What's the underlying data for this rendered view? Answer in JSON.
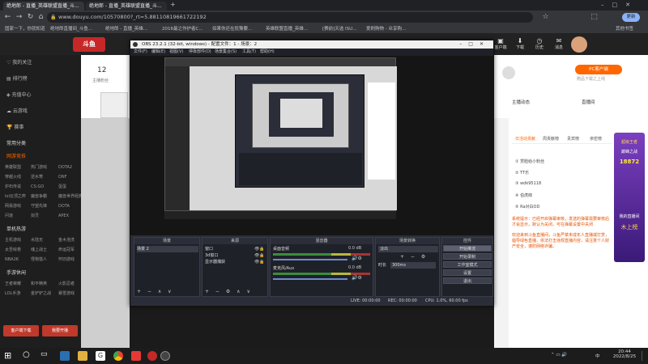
{
  "browser": {
    "tabs": [
      {
        "label": "绝地郎 - 直播_英雄联盟直播_斗..."
      },
      {
        "label": "绝地郎 - 直播_英雄联盟直播_斗..."
      }
    ],
    "new_tab": "+",
    "url": "www.douyu.com/10570800?_rt=5.88110819661722192",
    "bookmarks": [
      "国家一下，你就知道",
      "绝地郎直播间_斗鱼...",
      "绝地郎 - 直播_英雄...",
      "2016最之作护者C...",
      "如果你还在犹豫要...",
      "英雄联盟直播_英雄...",
      "[赛前]天选 ISU...",
      "爱刷购物 - 众享购..."
    ],
    "bookmarks_right": "其他书签"
  },
  "site": {
    "sidebar": {
      "items": [
        "我的关注",
        "排行榜",
        "充值中心",
        "云游戏",
        "赛事"
      ],
      "section_common": "常用分类",
      "section_games": "网游竞技",
      "games_grid": [
        "英雄联盟",
        "热门游戏",
        "DOTA2",
        "穿越火线",
        "逆水寒",
        "DNF",
        "炉石传说",
        "CS:GO",
        "蛋蛋",
        "lol云顶之弈",
        "魔兽争霸",
        "魔兽世界经典",
        "网易游戏",
        "守望先锋",
        "DOTA",
        "问道",
        "剑灵",
        "APEX"
      ],
      "section_mobile": "单机热游",
      "mobile_grid": [
        "主机游戏",
        "水陆无",
        "金木泡洗",
        "太吾绘卷",
        "魂上战士",
        "命运冠军",
        "NBA2K",
        "怪物猎人",
        "怀旧游戏"
      ],
      "section_hand": "手游休闲",
      "hand_grid": [
        "王者荣耀",
        "和平精英",
        "火影忍者",
        "LOL手游",
        "金铲铲之战",
        "暴雪游戏"
      ],
      "btn_left": "客户端下载",
      "btn_right": "我要开播"
    },
    "header_right": [
      "客户端",
      "下载",
      "历史",
      "消息"
    ],
    "top_count": "12",
    "top_label": "主播粉丝",
    "right_panel": {
      "btn": "PC客户端",
      "subtitle": "赠品下载之上线",
      "anchor_label": "主播动态",
      "live_label": "直播间",
      "tabs": [
        "日活动贡献",
        "周贡献榜",
        "贵宾榜",
        "亲密榜"
      ],
      "list": [
        "赏脸给小粉丝",
        "TT乐",
        "wdk95118",
        "伯虎郎",
        "Ra对白OD"
      ],
      "notice1": "系统提示：已经开启弹幕审核，发送的弹幕需要审核后才会显示，默认为关闭，可在弹幕设置中关闭",
      "notice2": "欢迎来到斗鱼直播间，斗鱼严禁未成年人直播或打赏，倡导绿色直播，依法打击违规直播内容，请注意个人财产安全，谨防网络诈骗。"
    },
    "promo": {
      "title": "超级王者",
      "sub": "巅峰之战",
      "num": "18872",
      "footer": "我的直播间",
      "sub2": "木上榜"
    }
  },
  "obs": {
    "title": "OBS 23.2.1 (32-bit, windows) - 配置文件：1 - 场景：2",
    "menu": [
      "文件(F)",
      "编辑(E)",
      "视图(V)",
      "停靠部件(D)",
      "场景集合(S)",
      "工具(T)",
      "帮助(H)"
    ],
    "docks": {
      "scenes": {
        "title": "场景",
        "items": [
          "场景 2"
        ]
      },
      "sources": {
        "title": "来源",
        "items": [
          "窗口",
          "3d窗口",
          "显示器捕获"
        ]
      },
      "mixer": {
        "title": "混音器",
        "ch1": "桌面音频",
        "ch2": "麦克风/Aux",
        "db1": "0.0 dB",
        "db2": "0.0 dB"
      },
      "transitions": {
        "title": "场景转换",
        "mode": "淡出",
        "duration_label": "时长",
        "duration": "300ms"
      },
      "controls": {
        "title": "控件",
        "buttons": [
          "开始推流",
          "开始录制",
          "工作室模式",
          "设置",
          "退出"
        ]
      }
    },
    "status": {
      "live": "LIVE: 00:00:00",
      "rec": "REC: 00:00:00",
      "cpu": "CPU: 1.0%, 60.00 fps"
    }
  },
  "taskbar": {
    "time": "20:44",
    "date": "2022/8/25",
    "lang": "中"
  }
}
